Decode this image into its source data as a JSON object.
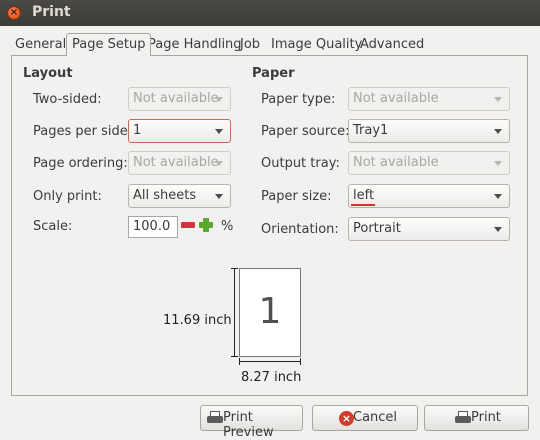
{
  "window": {
    "title": "Print",
    "close_glyph": "×"
  },
  "tabs": [
    "General",
    "Page Setup",
    "Page Handling",
    "Job",
    "Image Quality",
    "Advanced"
  ],
  "active_tab": "Page Setup",
  "layout": {
    "title": "Layout",
    "two_sided": {
      "label": "Two-sided:",
      "value": "Not available"
    },
    "pages_per_side": {
      "label": "Pages per side:",
      "value": "1"
    },
    "page_ordering": {
      "label": "Page ordering:",
      "value": "Not available"
    },
    "only_print": {
      "label": "Only print:",
      "value": "All sheets"
    },
    "scale": {
      "label": "Scale:",
      "value": "100.0",
      "unit": "%"
    }
  },
  "paper": {
    "title": "Paper",
    "paper_type": {
      "label": "Paper type:",
      "value": "Not available"
    },
    "paper_source": {
      "label": "Paper source:",
      "value": "Tray1"
    },
    "output_tray": {
      "label": "Output tray:",
      "value": "Not available"
    },
    "paper_size": {
      "label": "Paper size:",
      "value": "left"
    },
    "orientation": {
      "label": "Orientation:",
      "value": "Portrait"
    }
  },
  "preview": {
    "page_number": "1",
    "height_label": "11.69 inch",
    "width_label": "8.27 inch"
  },
  "buttons": {
    "print_preview": "Print Preview",
    "cancel": "Cancel",
    "print": "Print"
  },
  "colors": {
    "titlebar": "#3c3b37",
    "close": "#e8541c",
    "spell_error": "#e0302c",
    "minus": "#d6333d",
    "plus": "#5aa82c"
  }
}
